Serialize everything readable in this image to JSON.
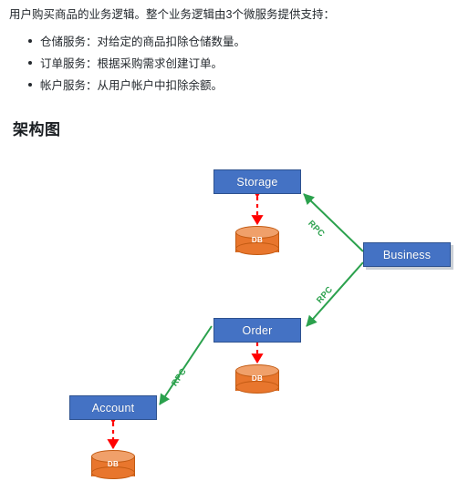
{
  "document": {
    "intro": "用户购买商品的业务逻辑。整个业务逻辑由3个微服务提供支持：",
    "bullets": [
      "仓储服务：对给定的商品扣除仓储数量。",
      "订单服务：根据采购需求创建订单。",
      "帐户服务：从用户帐户中扣除余额。"
    ],
    "heading": "架构图"
  },
  "diagram": {
    "colors": {
      "service_fill": "#4472C4",
      "service_border": "#2E528F",
      "db_fill": "#E8762D",
      "db_top": "#F0A06A",
      "db_border": "#C25A12",
      "rpc_line": "#2BA14D",
      "db_arrow": "#FF0000"
    },
    "nodes": [
      {
        "id": "storage",
        "label": "Storage",
        "type": "service"
      },
      {
        "id": "business",
        "label": "Business",
        "type": "service"
      },
      {
        "id": "order",
        "label": "Order",
        "type": "service"
      },
      {
        "id": "account",
        "label": "Account",
        "type": "service"
      },
      {
        "id": "storage-db",
        "label": "DB",
        "type": "database"
      },
      {
        "id": "order-db",
        "label": "DB",
        "type": "database"
      },
      {
        "id": "account-db",
        "label": "DB",
        "type": "database"
      }
    ],
    "edges": [
      {
        "from": "business",
        "to": "storage",
        "label": "RPC",
        "style": "solid-green-arrow"
      },
      {
        "from": "business",
        "to": "order",
        "label": "RPC",
        "style": "solid-green-arrow"
      },
      {
        "from": "order",
        "to": "account",
        "label": "RPC",
        "style": "solid-green-arrow"
      },
      {
        "from": "storage",
        "to": "storage-db",
        "label": "",
        "style": "red-dashed-double-arrow"
      },
      {
        "from": "order",
        "to": "order-db",
        "label": "",
        "style": "red-dashed-double-arrow"
      },
      {
        "from": "account",
        "to": "account-db",
        "label": "",
        "style": "red-dashed-double-arrow"
      }
    ]
  }
}
